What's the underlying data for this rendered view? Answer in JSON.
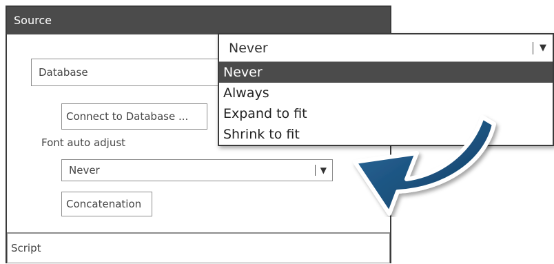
{
  "panel": {
    "header": "Source",
    "database_field": "Database",
    "connect_button": "Connect to Database ...",
    "font_label": "Font auto adjust",
    "font_select_value": "Never",
    "concatenation_button": "Concatenation",
    "script_field": "Script"
  },
  "dropdown": {
    "selected_value": "Never",
    "options": [
      "Never",
      "Always",
      "Expand to fit",
      "Shrink to fit"
    ],
    "highlighted_index": 0
  },
  "colors": {
    "header_bg": "#4b4b4b",
    "arrow": "#1a4f7a"
  }
}
